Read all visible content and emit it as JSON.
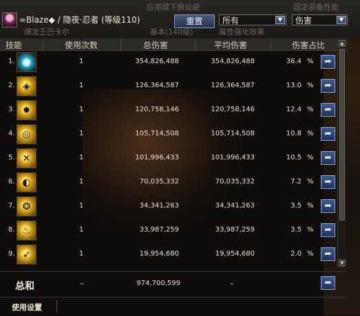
{
  "header": {
    "title": "∞Blaze◆ / 隐夜·忍者 (等级110)",
    "reset_button": "重置",
    "filter_select": "所有",
    "type_select": "伤害",
    "ghost_text_1": "应用理下做设避",
    "ghost_text_2": "固定装备性能",
    "ghost_text_3": "爆龙王巴卡尔",
    "ghost_text_4": "基本(140级)",
    "ghost_text_5": "属性强化效果"
  },
  "columns": [
    "技能",
    "使用次数",
    "总伤害",
    "平均伤害",
    "伤害占比"
  ],
  "rows": [
    {
      "index": "1.",
      "icon": "blue-orb-skill-icon",
      "count": "1",
      "total": "354,826,488",
      "average": "354,826,488",
      "percent": "36.4",
      "sign": "%"
    },
    {
      "index": "2.",
      "icon": "gold-dragon-skill-icon",
      "count": "1",
      "total": "126,364,587",
      "average": "126,364,587",
      "percent": "13.0",
      "sign": "%"
    },
    {
      "index": "3.",
      "icon": "gold-burst-skill-icon",
      "count": "1",
      "total": "120,758,146",
      "average": "120,758,146",
      "percent": "12.4",
      "sign": "%"
    },
    {
      "index": "4.",
      "icon": "gold-ring-skill-icon",
      "count": "1",
      "total": "105,714,508",
      "average": "105,714,508",
      "percent": "10.8",
      "sign": "%"
    },
    {
      "index": "5.",
      "icon": "gold-cross-skill-icon",
      "count": "1",
      "total": "101,996,433",
      "average": "101,996,433",
      "percent": "10.5",
      "sign": "%"
    },
    {
      "index": "6.",
      "icon": "gold-spiral-skill-icon",
      "count": "1",
      "total": "70,035,332",
      "average": "70,035,332",
      "percent": "7.2",
      "sign": "%"
    },
    {
      "index": "7.",
      "icon": "gold-beast-skill-icon",
      "count": "1",
      "total": "34,341,263",
      "average": "34,341,263",
      "percent": "3.5",
      "sign": "%"
    },
    {
      "index": "8.",
      "icon": "gold-flame-skill-icon",
      "count": "1",
      "total": "33,987,259",
      "average": "33,987,259",
      "percent": "3.5",
      "sign": "%"
    },
    {
      "index": "9.",
      "icon": "gold-blade-skill-icon",
      "count": "1",
      "total": "19,954,680",
      "average": "19,954,680",
      "percent": "2.0",
      "sign": "%"
    }
  ],
  "totals": {
    "label": "总和",
    "count": "–",
    "total": "974,700,599",
    "average": "–"
  },
  "footer": {
    "settings_label": "使用设置"
  },
  "colors": {
    "background": "#0f0d0b",
    "header_bg": "#2b2a27",
    "button_blue": "#3e5a8e",
    "text": "#e8e2d4"
  }
}
